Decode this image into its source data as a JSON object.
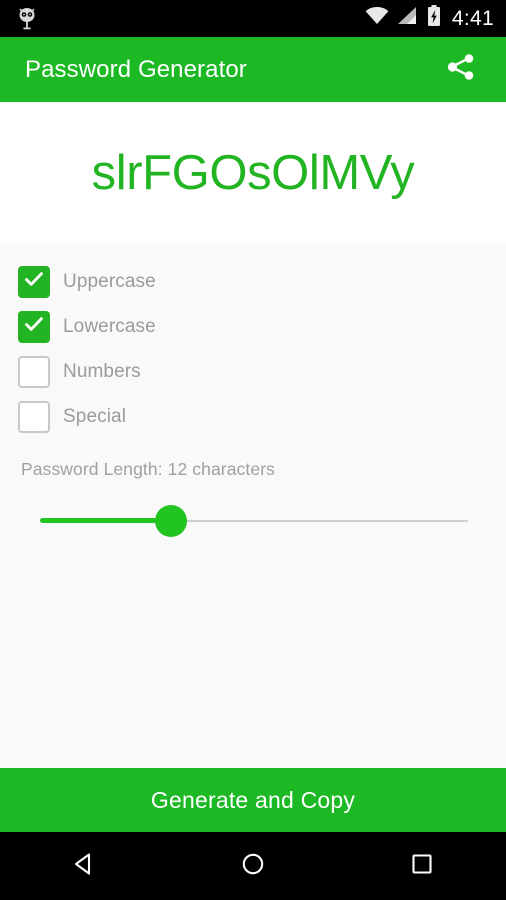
{
  "status_bar": {
    "notification_icon": "owl-notification-icon",
    "wifi_icon": "wifi-icon",
    "signal_icon": "cellular-signal-icon",
    "battery_icon": "battery-charging-icon",
    "time": "4:41",
    "background_color": "#000000"
  },
  "app_bar": {
    "title": "Password Generator",
    "share_icon": "share-icon",
    "background_color": "#1db924",
    "title_color": "#ffffff"
  },
  "password": {
    "value": "slrFGOsOlMVy",
    "color": "#22b422",
    "background_color": "#ffffff"
  },
  "options": {
    "checkboxes": [
      {
        "label": "Uppercase",
        "checked": true
      },
      {
        "label": "Lowercase",
        "checked": true
      },
      {
        "label": "Numbers",
        "checked": false
      },
      {
        "label": "Special",
        "checked": false
      }
    ],
    "length_label": "Password Length: 12 characters",
    "length_value": 12,
    "slider": {
      "fill_color": "#22c422",
      "thumb_color": "#22c422",
      "track_color": "#cfcfcf"
    },
    "label_color": "#9b9b9b",
    "background_color": "#f9f9f9"
  },
  "footer": {
    "generate_label": "Generate and Copy",
    "background_color": "#1db924"
  },
  "nav_bar": {
    "back_icon": "back-triangle-icon",
    "home_icon": "home-circle-icon",
    "recents_icon": "recents-square-icon",
    "background_color": "#000000"
  }
}
